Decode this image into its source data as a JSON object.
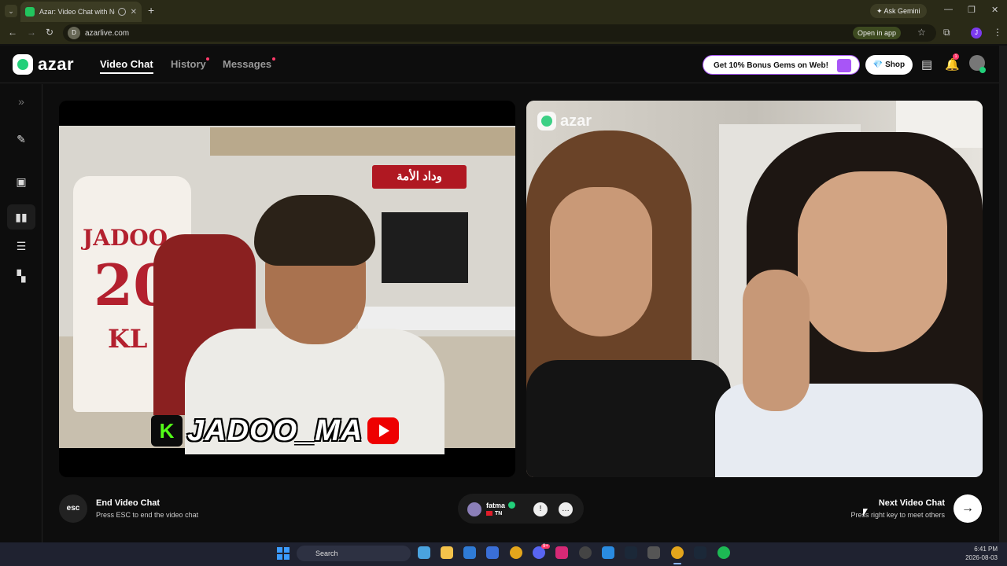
{
  "browser": {
    "tab_title": "Azar: Video Chat with New",
    "url": "azarlive.com",
    "ask_gemini": "Ask Gemini",
    "open_in_app": "Open in app",
    "profile_initial": "J",
    "site_initial": "D"
  },
  "app": {
    "logo_text": "azar",
    "nav": [
      {
        "label": "Video Chat",
        "active": true
      },
      {
        "label": "History",
        "dot": true
      },
      {
        "label": "Messages",
        "dot": true
      }
    ],
    "bonus_label": "Get 10% Bonus Gems on Web!",
    "shop_label": "Shop",
    "notification_count": "1"
  },
  "video": {
    "left": {
      "jersey_name": "JADOO",
      "jersey_number": "20",
      "jersey_letters": "KL",
      "scarf_text": "وداد الأمة",
      "overlay_kick": "K",
      "overlay_name": "JADOO_MA"
    },
    "right": {
      "watermark": "azar"
    }
  },
  "controls": {
    "esc_key": "esc",
    "end_title": "End Video Chat",
    "end_sub": "Press ESC to end the video chat",
    "partner_name": "fatma",
    "partner_country": "TN",
    "next_title": "Next Video Chat",
    "next_sub": "Press right key to meet others"
  },
  "taskbar": {
    "search_placeholder": "Search",
    "time": "6:41 PM",
    "date": "2026-08-03",
    "discord_badge": "9+"
  }
}
